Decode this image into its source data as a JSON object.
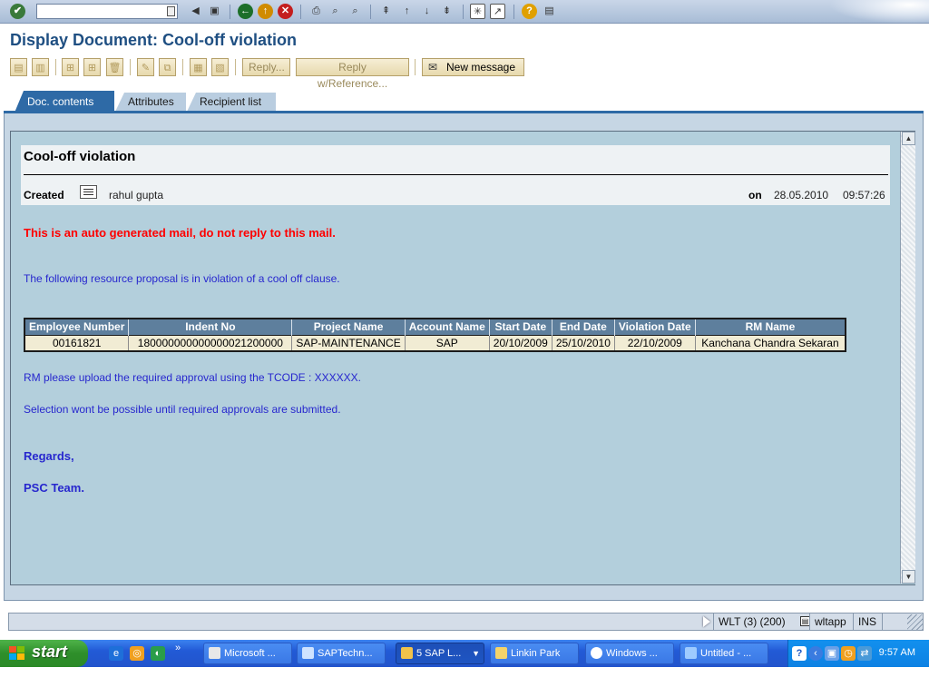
{
  "system_toolbar": {
    "command_field_value": ""
  },
  "title": "Display Document: Cool-off violation",
  "app_toolbar": {
    "reply": "Reply...",
    "reply_with_reference": "Reply w/Reference...",
    "new_message": "New message"
  },
  "tabs": [
    {
      "label": "Doc. contents",
      "active": true
    },
    {
      "label": "Attributes",
      "active": false
    },
    {
      "label": "Recipient list",
      "active": false
    }
  ],
  "document": {
    "subject": "Cool-off violation",
    "created_label": "Created",
    "author": "rahul gupta",
    "on_label": "on",
    "date": "28.05.2010",
    "time": "09:57:26",
    "warning": "This is an auto generated mail, do not reply to this mail.",
    "intro": "The following resource proposal is in violation of a cool off clause.",
    "table": {
      "headers": [
        "Employee Number",
        "Indent No",
        "Project Name",
        "Account Name",
        "Start Date",
        "End Date",
        "Violation Date",
        "RM Name"
      ],
      "rows": [
        [
          "00161821",
          "180000000000000021200000",
          "SAP-MAINTENANCE",
          "SAP",
          "20/10/2009",
          "25/10/2010",
          "22/10/2009",
          "Kanchana Chandra Sekaran"
        ]
      ]
    },
    "upload_note": "RM please upload the required approval using the TCODE : XXXXXX.",
    "selection_note": "Selection wont be possible until required approvals are submitted.",
    "regards": "Regards,",
    "signature": "PSC Team."
  },
  "status_bar": {
    "system": "WLT (3) (200)",
    "server": "wltapp",
    "mode": "INS"
  },
  "taskbar": {
    "start_label": "start",
    "chevron": "»",
    "buttons": [
      {
        "label": "Microsoft ...",
        "active": false
      },
      {
        "label": "SAPTechn...",
        "active": false
      },
      {
        "label": "5 SAP L...",
        "active": true
      },
      {
        "label": "Linkin Park",
        "active": false
      },
      {
        "label": "Windows ...",
        "active": false
      },
      {
        "label": "Untitled - ...",
        "active": false
      }
    ],
    "clock": "9:57 AM"
  },
  "colors": {
    "title_blue": "#1f4f82",
    "tab_active": "#2e6aa6",
    "doc_background": "#b3cfdc",
    "body_text": "#2727ce",
    "warning_red": "#ff0000",
    "table_header": "#5e7f9d",
    "table_cell": "#f1ecd4"
  }
}
